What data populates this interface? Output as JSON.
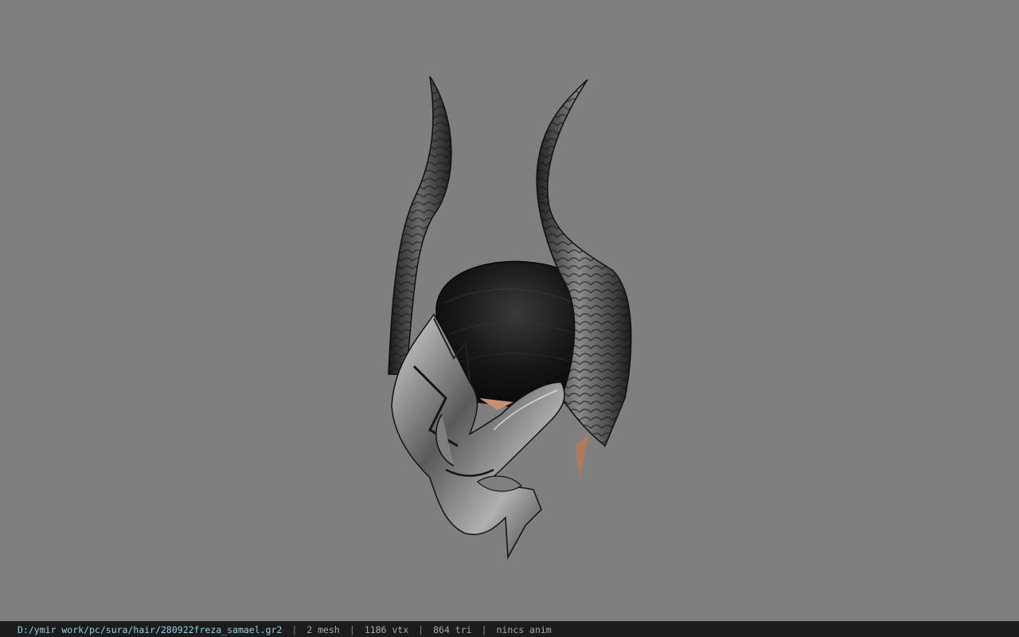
{
  "viewer": {
    "background_color": "#7f7f7f",
    "model_name": "280922freza_samael.gr2"
  },
  "status_bar": {
    "file_path": "D:/ymir work/pc/sura/hair/280922freza_samael.gr2",
    "separator": "|",
    "mesh_count": "2 mesh",
    "vertex_count": "1186 vtx",
    "triangle_count": "864 tri",
    "animation": "nincs anim",
    "path_color": "#8fd3e6",
    "bar_color": "#1c1c1c"
  }
}
